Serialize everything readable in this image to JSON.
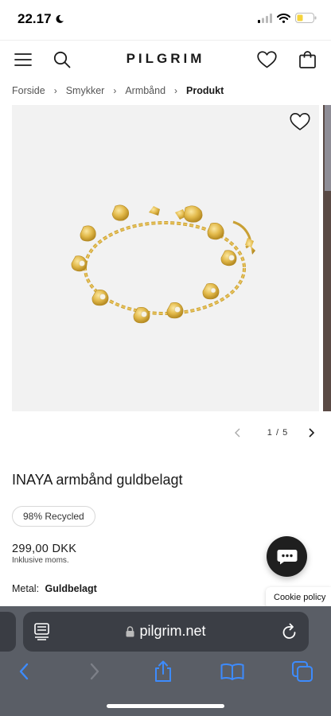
{
  "status_bar": {
    "time": "22.17",
    "battery_color": "#f5d33c"
  },
  "header": {
    "logo": "PILGRIM"
  },
  "breadcrumb": {
    "items": [
      "Forside",
      "Smykker",
      "Armbånd"
    ],
    "current": "Produkt"
  },
  "gallery": {
    "counter": "1 / 5"
  },
  "product": {
    "title": "INAYA armbånd guldbelagt",
    "badge": "98% Recycled",
    "price": "299,00 DKK",
    "tax_note": "Inklusive moms.",
    "metal_label": "Metal:",
    "metal_value": "Guldbelagt"
  },
  "cookie": {
    "label": "Cookie policy"
  },
  "browser": {
    "url": "pilgrim.net",
    "accent": "#3d8bfd"
  },
  "icons": [
    "menu-icon",
    "search-icon",
    "heart-icon",
    "bag-icon",
    "wishlist-heart-icon",
    "chevron-left-icon",
    "chevron-right-icon",
    "chat-icon",
    "tabs-icon",
    "lock-icon",
    "reload-icon",
    "back-icon",
    "forward-icon",
    "share-icon",
    "bookmarks-icon",
    "tab-overview-icon"
  ]
}
